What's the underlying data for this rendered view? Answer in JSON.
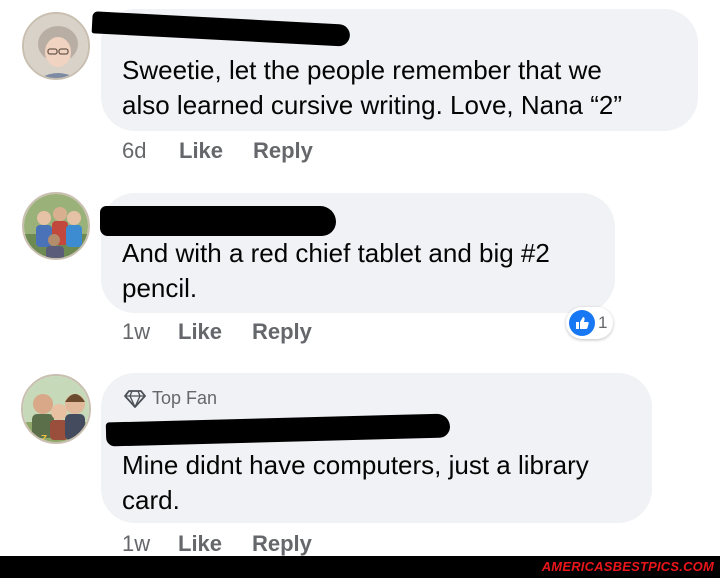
{
  "comments": [
    {
      "text": "Sweetie, let the people remember that we\nalso learned cursive writing.  Love, Nana “2”",
      "time": "6d",
      "like_label": "Like",
      "reply_label": "Reply"
    },
    {
      "text": "And with a red chief tablet and big #2\npencil.",
      "time": "1w",
      "like_label": "Like",
      "reply_label": "Reply",
      "reaction_count": "1"
    },
    {
      "badge_label": "Top Fan",
      "text": "Mine didnt have computers, just a library\ncard.",
      "time": "1w",
      "like_label": "Like",
      "reply_label": "Reply"
    }
  ],
  "watermark": "AMERICASBESTPICS.COM",
  "colors": {
    "bubble": "#f0f2f5",
    "meta_text": "#65676b",
    "like_blue": "#1877f2",
    "watermark": "#e8161b"
  },
  "icons": {
    "reaction": "thumbs-up-icon",
    "top_fan": "diamond-icon"
  }
}
